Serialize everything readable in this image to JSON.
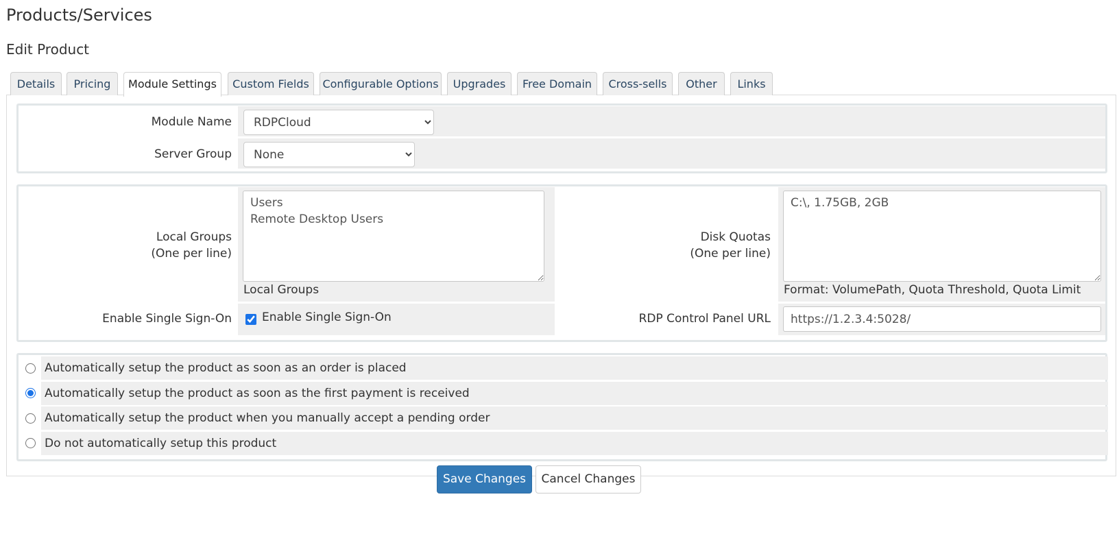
{
  "page": {
    "title": "Products/Services",
    "subtitle": "Edit Product"
  },
  "tabs": [
    {
      "label": "Details"
    },
    {
      "label": "Pricing"
    },
    {
      "label": "Module Settings",
      "active": true
    },
    {
      "label": "Custom Fields"
    },
    {
      "label": "Configurable Options"
    },
    {
      "label": "Upgrades"
    },
    {
      "label": "Free Domain"
    },
    {
      "label": "Cross-sells"
    },
    {
      "label": "Other"
    },
    {
      "label": "Links"
    }
  ],
  "module": {
    "module_name_label": "Module Name",
    "module_name_value": "RDPCloud",
    "server_group_label": "Server Group",
    "server_group_value": "None"
  },
  "config": {
    "local_groups_label": "Local Groups",
    "local_groups_sublabel": "(One per line)",
    "local_groups_value": "Users\nRemote Desktop Users",
    "local_groups_help": "Local Groups",
    "disk_quotas_label": "Disk Quotas",
    "disk_quotas_sublabel": "(One per line)",
    "disk_quotas_value": "C:\\, 1.75GB, 2GB",
    "disk_quotas_help": "Format: VolumePath, Quota Threshold, Quota Limit",
    "sso_label": "Enable Single Sign-On",
    "sso_checkbox_label": "Enable Single Sign-On",
    "sso_checked": true,
    "rdp_url_label": "RDP Control Panel URL",
    "rdp_url_value": "https://1.2.3.4:5028/"
  },
  "setup_options": [
    {
      "label": "Automatically setup the product as soon as an order is placed",
      "checked": false
    },
    {
      "label": "Automatically setup the product as soon as the first payment is received",
      "checked": true
    },
    {
      "label": "Automatically setup the product when you manually accept a pending order",
      "checked": false
    },
    {
      "label": "Do not automatically setup this product",
      "checked": false
    }
  ],
  "buttons": {
    "save_label": "Save Changes",
    "cancel_label": "Cancel Changes"
  },
  "colors": {
    "primary": "#337ab7",
    "tab_text": "#2b4763",
    "row_bg": "#efefef"
  }
}
